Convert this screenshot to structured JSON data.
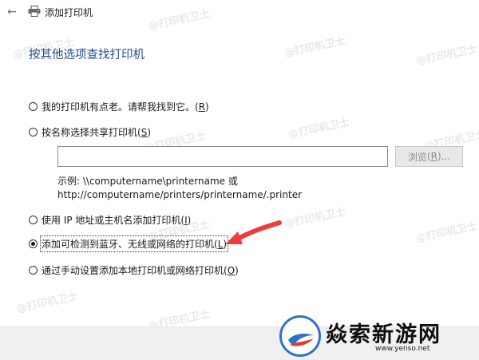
{
  "window": {
    "title": "添加打印机"
  },
  "heading": "按其他选项查找打印机",
  "options": [
    {
      "label": "我的打印机有点老。请帮我找到它。",
      "key": "R",
      "checked": false
    },
    {
      "label": "按名称选择共享打印机",
      "key": "S",
      "checked": false
    },
    {
      "label": "使用 IP 地址或主机名添加打印机",
      "key": "I",
      "checked": false
    },
    {
      "label": "添加可检测到蓝牙、无线或网络的打印机",
      "key": "L",
      "checked": true
    },
    {
      "label": "通过手动设置添加本地打印机或网络打印机",
      "key": "O",
      "checked": false
    }
  ],
  "share_input": {
    "value": ""
  },
  "browse": {
    "label": "浏览",
    "key": "R",
    "suffix": "..."
  },
  "example": {
    "line1": "示例: \\\\computername\\printername 或",
    "line2": "http://computername/printers/printername/.printer"
  },
  "watermark": "@打印机卫士",
  "brand": {
    "name": "焱索新游网",
    "url": "www.yenso.net"
  },
  "colors": {
    "heading": "#1f4e96",
    "arrow": "#ee3b3b",
    "brand_blue": "#2f72c8"
  },
  "icons": {
    "back": "back-arrow-icon",
    "printer": "printer-icon"
  }
}
